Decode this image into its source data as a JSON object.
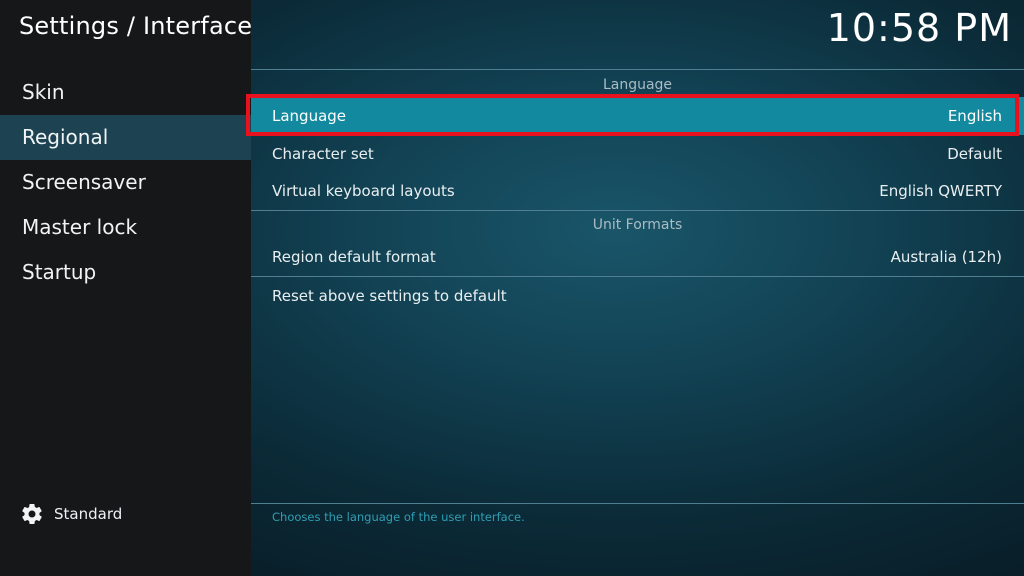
{
  "header": {
    "title": "Settings / Interface",
    "clock": "10:58 PM"
  },
  "sidebar": {
    "items": [
      {
        "label": "Skin"
      },
      {
        "label": "Regional"
      },
      {
        "label": "Screensaver"
      },
      {
        "label": "Master lock"
      },
      {
        "label": "Startup"
      }
    ],
    "active_index": 1,
    "settings_level": {
      "label": "Standard",
      "icon": "gear-icon"
    }
  },
  "main": {
    "groups": [
      {
        "title": "Language",
        "rows": [
          {
            "label": "Language",
            "value": "English"
          },
          {
            "label": "Character set",
            "value": "Default"
          },
          {
            "label": "Virtual keyboard layouts",
            "value": "English QWERTY"
          }
        ]
      },
      {
        "title": "Unit Formats",
        "rows": [
          {
            "label": "Region default format",
            "value": "Australia (12h)"
          }
        ]
      }
    ],
    "reset_label": "Reset above settings to default",
    "description": "Chooses the language of the user interface."
  },
  "colors": {
    "focus": "#12899f",
    "highlight_border": "#e8121e",
    "sidebar_active": "#1d4353",
    "hint_text": "#2e9fb3"
  }
}
